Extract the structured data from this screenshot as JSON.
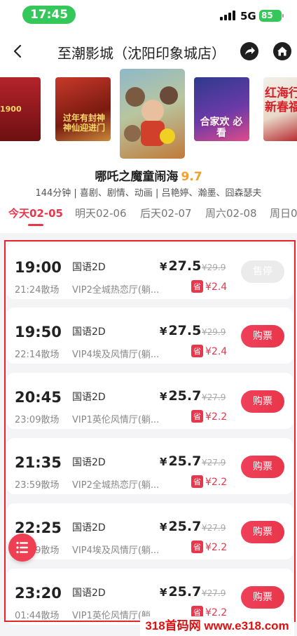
{
  "status": {
    "time": "17:45",
    "network": "5G",
    "battery": "85"
  },
  "nav": {
    "title": "至潮影城（沈阳印象城店）",
    "back_icon": "chevron-left-icon",
    "share_icon": "share-icon",
    "home_icon": "home-icon"
  },
  "posters": [
    {
      "text": "1900"
    },
    {
      "text": "过年有封神 神仙迎进门"
    },
    {
      "text": ""
    },
    {
      "text": "合家欢 必看"
    },
    {
      "text": "红海行 新春福"
    }
  ],
  "movie": {
    "title": "哪吒之魔童闹海",
    "score": "9.7",
    "meta": "144分钟 | 喜剧、剧情、动画 | 吕艳婷、瀚墨、囧森瑟夫"
  },
  "tabs": [
    {
      "label": "今天02-05",
      "active": true
    },
    {
      "label": "明天02-06",
      "active": false
    },
    {
      "label": "后天02-07",
      "active": false
    },
    {
      "label": "周六02-08",
      "active": false
    },
    {
      "label": "周日0",
      "active": false
    }
  ],
  "showtimes": [
    {
      "start": "19:00",
      "end": "21:24散场",
      "lang": "国语2D",
      "hall": "VIP2全城热恋厅(躺...",
      "price": "27.5",
      "orig": "¥29.9",
      "save_tag": "省",
      "save": "¥2.4",
      "button": "售停",
      "available": false
    },
    {
      "start": "19:50",
      "end": "22:14散场",
      "lang": "国语2D",
      "hall": "VIP4埃及风情厅(躺...",
      "price": "27.5",
      "orig": "¥29.9",
      "save_tag": "省",
      "save": "¥2.4",
      "button": "购票",
      "available": true
    },
    {
      "start": "20:45",
      "end": "23:09散场",
      "lang": "国语2D",
      "hall": "VIP1英伦风情厅(躺...",
      "price": "25.7",
      "orig": "¥27.9",
      "save_tag": "省",
      "save": "¥2.2",
      "button": "购票",
      "available": true
    },
    {
      "start": "21:35",
      "end": "23:59散场",
      "lang": "国语2D",
      "hall": "VIP2全城热恋厅(躺...",
      "price": "25.7",
      "orig": "¥27.9",
      "save_tag": "省",
      "save": "¥2.2",
      "button": "购票",
      "available": true
    },
    {
      "start": "22:25",
      "end": "00:49散场",
      "lang": "国语2D",
      "hall": "VIP4埃及风情厅(躺...",
      "price": "25.7",
      "orig": "¥27.9",
      "save_tag": "省",
      "save": "¥2.2",
      "button": "购票",
      "available": true
    },
    {
      "start": "23:20",
      "end": "01:44散场",
      "lang": "国语2D",
      "hall": "VIP1英伦风情厅(躺...",
      "price": "25.7",
      "orig": "¥27.9",
      "save_tag": "省",
      "save": "¥2.2",
      "button": "购票",
      "available": true
    }
  ],
  "currency": "¥",
  "fab_icon": "list-menu-icon",
  "watermark": "318首码网 www.e318.com",
  "colors": {
    "accent": "#e8364a",
    "status_green": "#34c759",
    "highlight_border": "#e5252a",
    "score": "#f0a030"
  }
}
